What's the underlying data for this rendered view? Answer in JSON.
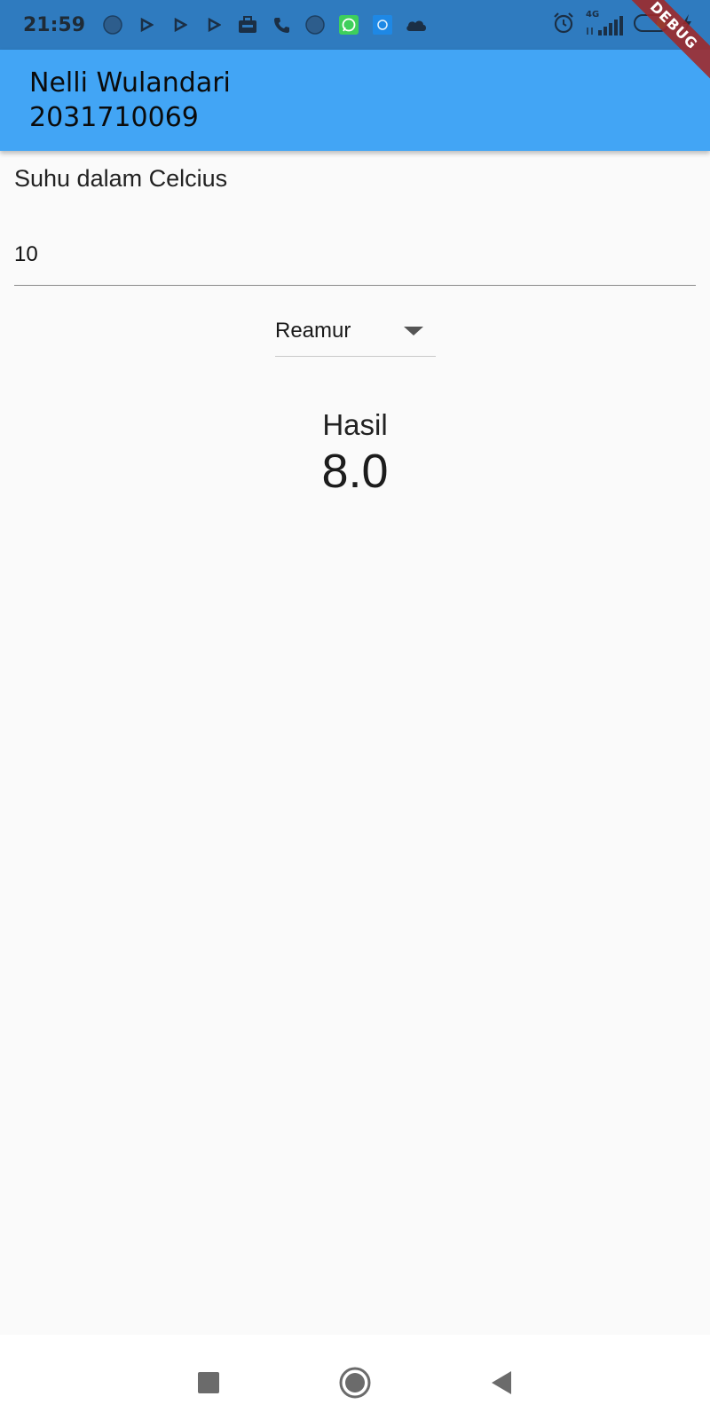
{
  "status_bar": {
    "time": "21:59",
    "network": "4G",
    "icons": [
      "circle-icon",
      "play-icon",
      "play-icon",
      "play-icon",
      "briefcase-icon",
      "phone-icon",
      "circle-icon",
      "whatsapp-icon",
      "app-icon",
      "cloud-icon",
      "alarm-icon",
      "signal-icon",
      "battery-icon",
      "charging-icon"
    ]
  },
  "app_bar": {
    "name": "Nelli Wulandari",
    "id": "2031710069",
    "color": "#42a5f5"
  },
  "debug_banner": "DEBUG",
  "form": {
    "label": "Suhu dalam Celcius",
    "input_value": "10",
    "dropdown_selected": "Reamur"
  },
  "result": {
    "label": "Hasil",
    "value": "8.0"
  },
  "nav": {
    "icons": [
      "recent-apps-icon",
      "home-icon",
      "back-icon"
    ]
  }
}
